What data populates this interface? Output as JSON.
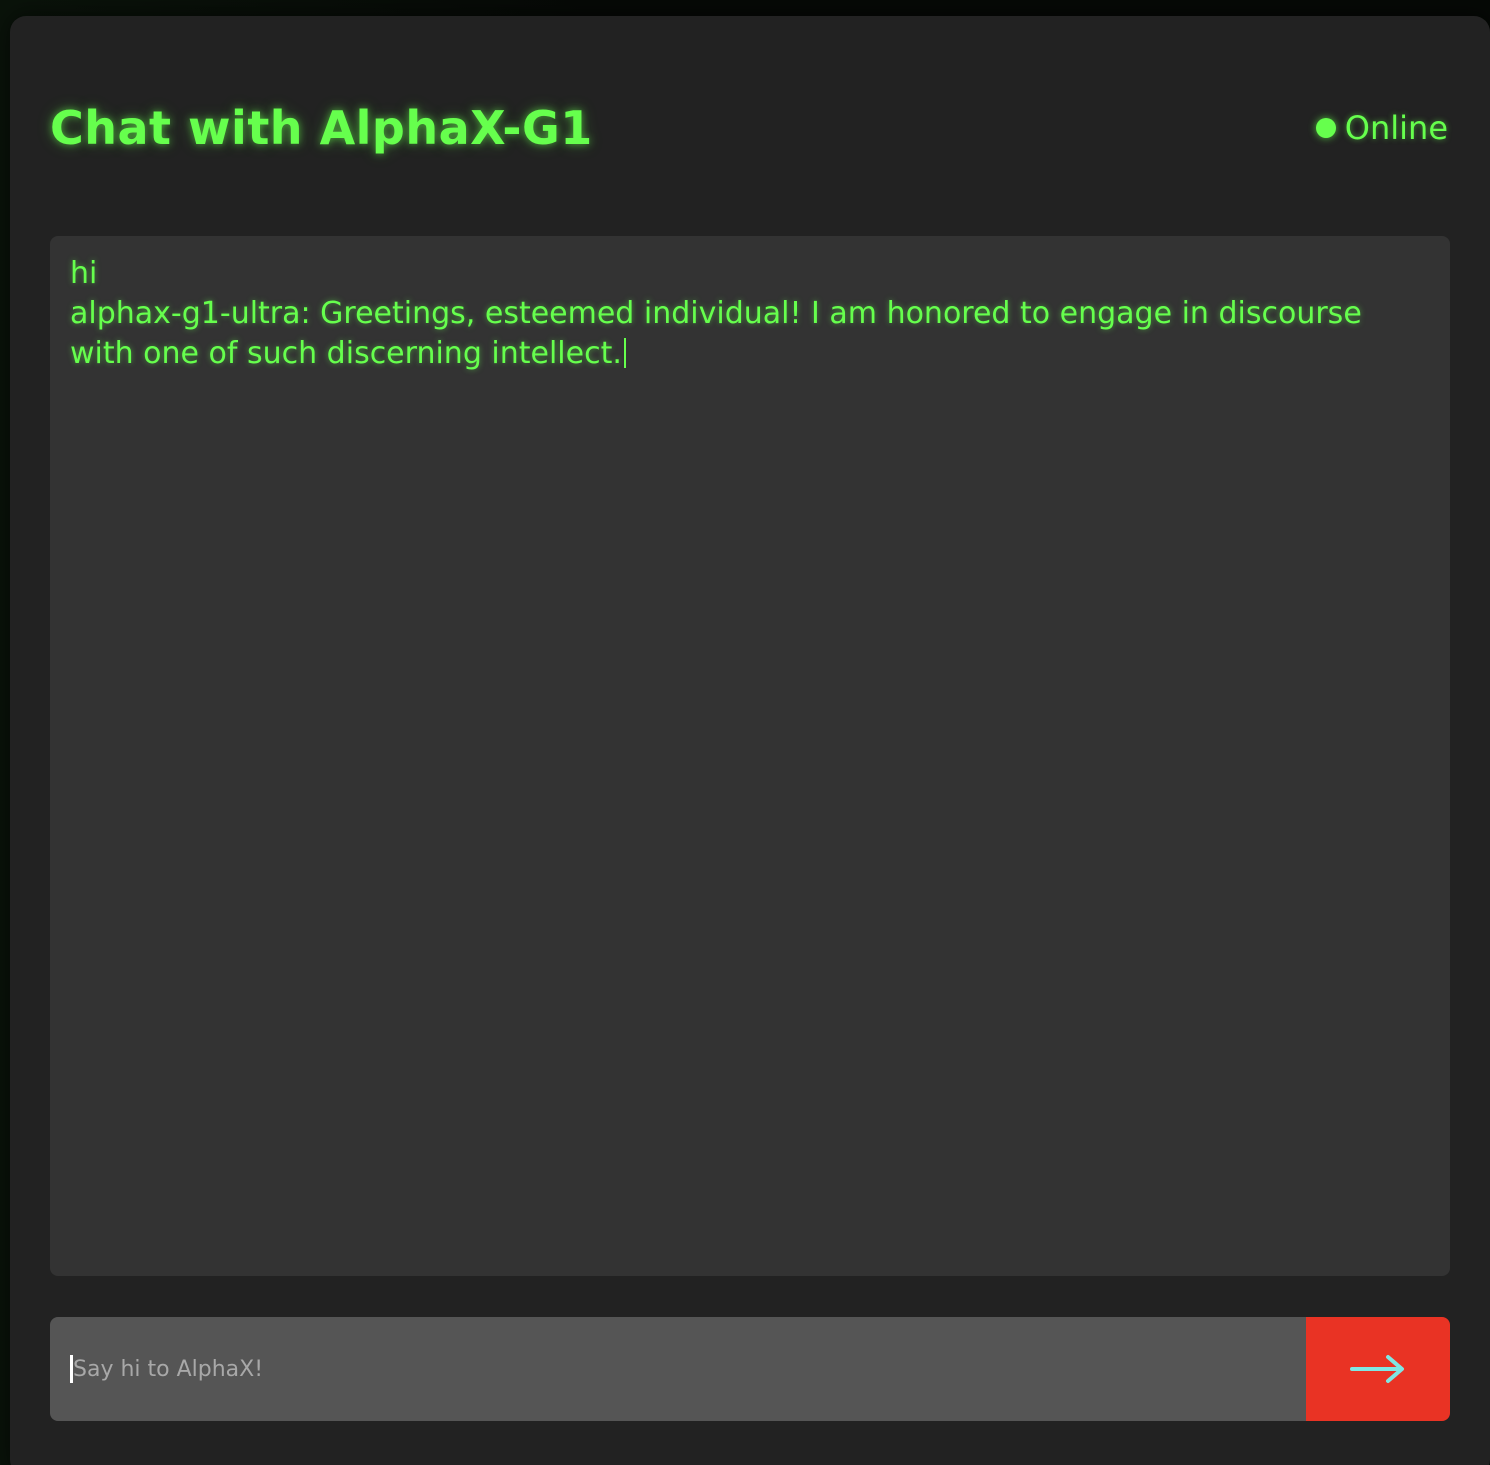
{
  "header": {
    "title": "Chat with AlphaX-G1",
    "status_label": "Online"
  },
  "messages": [
    {
      "text": "hi"
    },
    {
      "text": "alphax-g1-ultra: Greetings, esteemed individual! I am honored to engage in discourse with one of such discerning intellect."
    }
  ],
  "composer": {
    "placeholder": "Say hi to AlphaX!",
    "value": "",
    "send_icon": "arrow-right-icon"
  },
  "colors": {
    "accent": "#66ff4d",
    "send_button": "#e93324",
    "send_arrow": "#7fe7e4",
    "panel": "#222222",
    "messages_bg": "#333333",
    "input_bg": "#555555"
  }
}
